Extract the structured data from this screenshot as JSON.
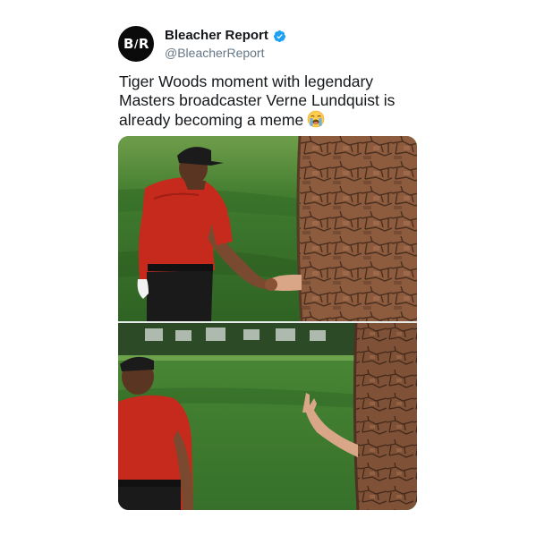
{
  "account": {
    "avatar_text_left": "B",
    "avatar_text_slash": "/",
    "avatar_text_right": "R",
    "display_name": "Bleacher Report",
    "handle": "@BleacherReport",
    "verified_color": "#1da1f2"
  },
  "tweet": {
    "text_lines": [
      "Tiger Woods moment with legendary",
      "Masters broadcaster Verne Lundquist is",
      "already becoming a meme"
    ],
    "emoji": "loudly-crying-face"
  },
  "media": {
    "images": [
      {
        "name": "handshake-frame"
      },
      {
        "name": "waving-hand-frame"
      }
    ]
  },
  "colors": {
    "grass": "#3f7a2e",
    "shirt": "#c62a1c",
    "bark": "#8a5a3c",
    "text": "#14171a",
    "muted": "#657786"
  }
}
